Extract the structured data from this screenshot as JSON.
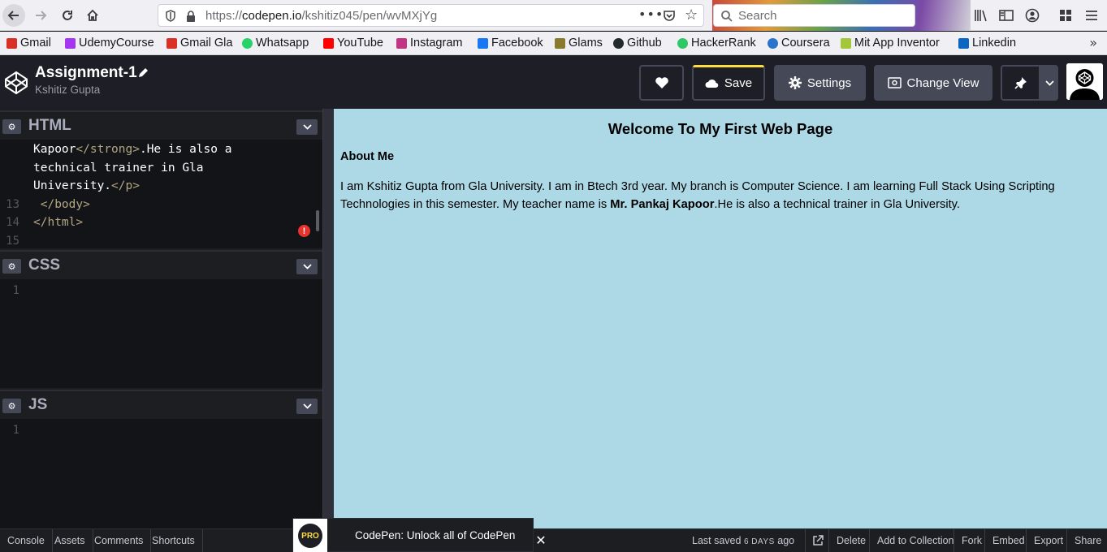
{
  "browser": {
    "url_prefix": "https://",
    "url_host": "codepen.io",
    "url_path": "/kshitiz045/pen/wvMXjYg",
    "search_placeholder": "Search"
  },
  "bookmarks": [
    {
      "label": "Gmail",
      "color": "#d93025"
    },
    {
      "label": "UdemyCourse",
      "color": "#a435f0"
    },
    {
      "label": "Gmail Gla",
      "color": "#d93025"
    },
    {
      "label": "Whatsapp",
      "color": "#25d366"
    },
    {
      "label": "YouTube",
      "color": "#ff0000"
    },
    {
      "label": "Instagram",
      "color": "#c13584"
    },
    {
      "label": "Facebook",
      "color": "#1877f2"
    },
    {
      "label": "Glams",
      "color": "#8a7a2e"
    },
    {
      "label": "Github",
      "color": "#24292e"
    },
    {
      "label": "HackerRank",
      "color": "#2ec866"
    },
    {
      "label": "Coursera",
      "color": "#2a73cc"
    },
    {
      "label": "Mit App Inventor",
      "color": "#a4c639"
    },
    {
      "label": "Linkedin",
      "color": "#0a66c2"
    }
  ],
  "header": {
    "title": "Assignment-1",
    "author": "Kshitiz Gupta",
    "save_label": "Save",
    "settings_label": "Settings",
    "change_view_label": "Change View"
  },
  "editors": {
    "html": {
      "title": "HTML",
      "lines": [
        {
          "num": "",
          "segments": [
            {
              "t": "Kapoor",
              "c": "text"
            },
            {
              "t": "</strong>",
              "c": "tag"
            },
            {
              "t": ".He is also a",
              "c": "text"
            }
          ]
        },
        {
          "num": "",
          "segments": [
            {
              "t": "technical trainer in Gla",
              "c": "text"
            }
          ]
        },
        {
          "num": "",
          "segments": [
            {
              "t": "University.",
              "c": "text"
            },
            {
              "t": "</p>",
              "c": "tag"
            }
          ]
        },
        {
          "num": "13",
          "segments": [
            {
              "t": " </body>",
              "c": "tag"
            }
          ]
        },
        {
          "num": "14",
          "segments": [
            {
              "t": "</html>",
              "c": "tag"
            }
          ]
        },
        {
          "num": "15",
          "segments": []
        }
      ]
    },
    "css": {
      "title": "CSS",
      "line_number": "1"
    },
    "js": {
      "title": "JS",
      "line_number": "1"
    }
  },
  "preview": {
    "heading": "Welcome To My First Web Page",
    "subheading": "About Me",
    "paragraph_before": "I am Kshitiz Gupta from Gla University. I am in Btech 3rd year. My branch is Computer Science. I am learning Full Stack Using Scripting Technologies in this semester. My teacher name is ",
    "paragraph_bold": "Mr. Pankaj Kapoor",
    "paragraph_after": ".He is also a technical trainer in Gla University.",
    "background": "#add8e6"
  },
  "footer": {
    "left_buttons": [
      "Console",
      "Assets",
      "Comments",
      "Shortcuts"
    ],
    "promo_badge": "PRO",
    "promo_text": "CodePen: Unlock all of CodePen",
    "last_saved_prefix": "Last saved ",
    "last_saved_time": "6 DAYS",
    "last_saved_suffix": " ago",
    "right_buttons": [
      "Delete",
      "Add to Collection",
      "Fork",
      "Embed",
      "Export",
      "Share"
    ]
  },
  "colors": {
    "accent": "#ffdd40",
    "editor_bg": "#131417",
    "header_bg": "#1e1f26",
    "error": "#e7322e"
  }
}
